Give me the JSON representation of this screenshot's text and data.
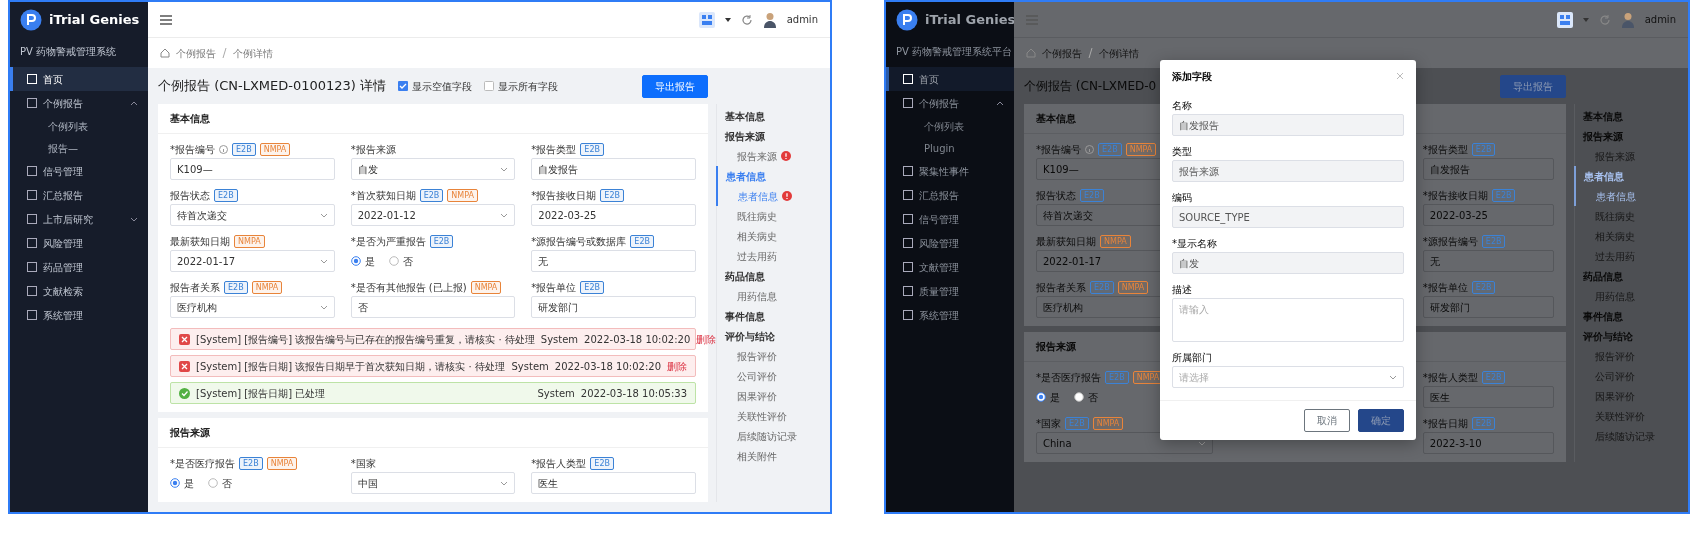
{
  "screens": [
    {
      "brand": "iTrial Genies",
      "subtitle": "PV 药物警戒管理系统",
      "menu": [
        {
          "label": "首页",
          "selected": true
        },
        {
          "label": "个例报告",
          "selected": false,
          "expanded": true,
          "children": [
            {
              "label": "个例列表"
            },
            {
              "label": "报告—"
            }
          ]
        },
        {
          "label": "信号管理",
          "selected": false
        },
        {
          "label": "汇总报告",
          "selected": false
        },
        {
          "label": "上市后研究",
          "selected": false,
          "expanded": false
        },
        {
          "label": "风险管理",
          "selected": false
        },
        {
          "label": "药品管理",
          "selected": false
        },
        {
          "label": "文献检索",
          "selected": false
        },
        {
          "label": "系统管理",
          "selected": false
        }
      ],
      "user": "admin",
      "breadcrumb": [
        "个例报告",
        "个例详情"
      ],
      "title": "个例报告 (CN-LXMED-0100123) 详情",
      "toggles": [
        {
          "label": "显示空值字段",
          "checked": true
        },
        {
          "label": "显示所有字段",
          "checked": false
        }
      ],
      "action": "导出报告",
      "sections": [
        {
          "title": "基本信息",
          "rows": [
            [
              {
                "label": "*报告编号",
                "info": true,
                "tags": [
                  {
                    "text": "E2B",
                    "color": "#3b82d6"
                  },
                  {
                    "text": "NMPA",
                    "color": "#e8843a"
                  }
                ],
                "kind": "input",
                "value": "K109—"
              },
              {
                "label": "*报告来源",
                "kind": "select",
                "value": "自发"
              },
              {
                "label": "*报告类型",
                "tags": [
                  {
                    "text": "E2B",
                    "color": "#3b82d6"
                  }
                ],
                "kind": "input",
                "value": "自发报告"
              }
            ],
            [
              {
                "label": "报告状态",
                "tags": [
                  {
                    "text": "E2B",
                    "color": "#3b82d6"
                  }
                ],
                "kind": "select",
                "value": "待首次递交"
              },
              {
                "label": "*首次获知日期",
                "tags": [
                  {
                    "text": "E2B",
                    "color": "#3b82d6"
                  },
                  {
                    "text": "NMPA",
                    "color": "#e8843a"
                  }
                ],
                "kind": "select",
                "value": "2022-01-12"
              },
              {
                "label": "*报告接收日期",
                "tags": [
                  {
                    "text": "E2B",
                    "color": "#3b82d6"
                  }
                ],
                "kind": "input",
                "value": "2022-03-25"
              }
            ],
            [
              {
                "label": "最新获知日期",
                "tags": [
                  {
                    "text": "NMPA",
                    "color": "#e8843a"
                  }
                ],
                "kind": "select",
                "value": "2022-01-17"
              },
              {
                "label": "*是否为严重报告",
                "tags": [
                  {
                    "text": "E2B",
                    "color": "#3b82d6"
                  }
                ],
                "kind": "radio",
                "options": [
                  {
                    "label": "是",
                    "selected": true
                  },
                  {
                    "label": "否",
                    "selected": false
                  }
                ]
              },
              {
                "label": "*源报告编号或数据库",
                "tags": [
                  {
                    "text": "E2B",
                    "color": "#3b82d6"
                  }
                ],
                "kind": "input",
                "value": "无"
              }
            ],
            [
              {
                "label": "报告者关系",
                "tags": [
                  {
                    "text": "E2B",
                    "color": "#3b82d6"
                  },
                  {
                    "text": "NMPA",
                    "color": "#e8843a"
                  }
                ],
                "kind": "select",
                "value": "医疗机构"
              },
              {
                "label": "*是否有其他报告 (已上报)",
                "tags": [
                  {
                    "text": "NMPA",
                    "color": "#e8843a"
                  }
                ],
                "kind": "input",
                "value": "否"
              },
              {
                "label": "*报告单位",
                "tags": [
                  {
                    "text": "E2B",
                    "color": "#3b82d6"
                  }
                ],
                "kind": "input",
                "value": "研发部门"
              }
            ]
          ],
          "alerts": [
            {
              "kind": "error",
              "text": "[System] [报告编号] 该报告编号与已存在的报告编号重复，请核实 · 待处理",
              "author": "System",
              "time": "2022-03-18 10:02:20",
              "action": "删除"
            },
            {
              "kind": "error",
              "text": "[System] [报告日期] 该报告日期早于首次获知日期，请核实 · 待处理",
              "author": "System",
              "time": "2022-03-18 10:02:20",
              "action": "删除"
            },
            {
              "kind": "success",
              "text": "[System] [报告日期] 已处理",
              "author": "System",
              "time": "2022-03-18 10:05:33"
            }
          ]
        },
        {
          "title": "报告来源",
          "rows": [
            [
              {
                "label": "*是否医疗报告",
                "tags": [
                  {
                    "text": "E2B",
                    "color": "#3b82d6"
                  },
                  {
                    "text": "NMPA",
                    "color": "#e8843a"
                  }
                ],
                "kind": "radio",
                "options": [
                  {
                    "label": "是",
                    "selected": true
                  },
                  {
                    "label": "否",
                    "selected": false
                  }
                ]
              },
              {
                "label": "*国家",
                "kind": "select",
                "value": "中国"
              },
              {
                "label": "*报告人类型",
                "tags": [
                  {
                    "text": "E2B",
                    "color": "#3b82d6"
                  }
                ],
                "kind": "input",
                "value": "医生"
              }
            ]
          ]
        }
      ],
      "anchors": [
        {
          "label": "基本信息",
          "selected": false
        },
        {
          "label": "报告来源",
          "selected": false,
          "children": [
            {
              "label": "报告来源",
              "selected": false,
              "flagged": true
            }
          ]
        },
        {
          "label": "患者信息",
          "selected": true,
          "children": [
            {
              "label": "患者信息",
              "selected": true,
              "flagged": true
            },
            {
              "label": "既往病史",
              "selected": false,
              "flagged": false
            },
            {
              "label": "相关病史",
              "selected": false,
              "flagged": false
            },
            {
              "label": "过去用药",
              "selected": false,
              "flagged": false
            }
          ]
        },
        {
          "label": "药品信息",
          "selected": false,
          "children": [
            {
              "label": "用药信息",
              "selected": false,
              "flagged": false
            }
          ]
        },
        {
          "label": "事件信息",
          "selected": false
        },
        {
          "label": "评价与结论",
          "selected": false,
          "children": [
            {
              "label": "报告评价",
              "selected": false,
              "flagged": false
            },
            {
              "label": "公司评价",
              "selected": false,
              "flagged": false
            },
            {
              "label": "因果评价",
              "selected": false,
              "flagged": false
            },
            {
              "label": "关联性评价",
              "selected": false,
              "flagged": false
            },
            {
              "label": "后续随访记录",
              "selected": false,
              "flagged": false
            },
            {
              "label": "相关附件",
              "selected": false,
              "flagged": false
            }
          ]
        }
      ]
    },
    {
      "brand": "iTrial Genies",
      "subtitle": "PV 药物警戒管理系统平台",
      "menu": [
        {
          "label": "首页",
          "selected": true
        },
        {
          "label": "个例报告",
          "selected": false,
          "expanded": true,
          "children": [
            {
              "label": "个例列表"
            },
            {
              "label": "Plugin"
            }
          ]
        },
        {
          "label": "聚集性事件",
          "selected": false
        },
        {
          "label": "汇总报告",
          "selected": false
        },
        {
          "label": "信号管理",
          "selected": false
        },
        {
          "label": "风险管理",
          "selected": false
        },
        {
          "label": "文献管理",
          "selected": false
        },
        {
          "label": "质量管理",
          "selected": false
        },
        {
          "label": "系统管理",
          "selected": false
        }
      ],
      "user": "admin",
      "breadcrumb": [
        "个例报告",
        "个例详情"
      ],
      "title": "个例报告 (CN-LXMED-0",
      "action": "导出报告",
      "sections": [
        {
          "title": "基本信息",
          "rows": [
            [
              {
                "label": "*报告编号",
                "info": true,
                "tags": [
                  {
                    "text": "E2B",
                    "color": "#3b82d6"
                  },
                  {
                    "text": "NMPA",
                    "color": "#e8843a"
                  }
                ],
                "kind": "input",
                "value": "K109—"
              },
              {
                "label": "*报告类型",
                "tags": [
                  {
                    "text": "E2B",
                    "color": "#3b82d6"
                  }
                ],
                "kind": "input",
                "value": "自发报告"
              }
            ],
            [
              {
                "label": "报告状态",
                "tags": [
                  {
                    "text": "E2B",
                    "color": "#3b82d6"
                  }
                ],
                "kind": "input",
                "value": "待首次递交"
              },
              {
                "label": "*报告接收日期",
                "tags": [
                  {
                    "text": "E2B",
                    "color": "#3b82d6"
                  }
                ],
                "kind": "input",
                "value": "2022-03-25"
              }
            ],
            [
              {
                "label": "最新获知日期",
                "tags": [
                  {
                    "text": "NMPA",
                    "color": "#e8843a"
                  }
                ],
                "kind": "input",
                "value": "2022-01-17"
              },
              {
                "label": "*源报告编号",
                "tags": [
                  {
                    "text": "E2B",
                    "color": "#3b82d6"
                  }
                ],
                "kind": "input",
                "value": "无"
              }
            ],
            [
              {
                "label": "报告者关系",
                "tags": [
                  {
                    "text": "E2B",
                    "color": "#3b82d6"
                  },
                  {
                    "text": "NMPA",
                    "color": "#e8843a"
                  }
                ],
                "kind": "input",
                "value": "医疗机构"
              },
              {
                "label": "*报告单位",
                "tags": [
                  {
                    "text": "E2B",
                    "color": "#3b82d6"
                  }
                ],
                "kind": "input",
                "value": "研发部门"
              }
            ]
          ]
        },
        {
          "title": "报告来源",
          "rows": [
            [
              {
                "label": "*是否医疗报告",
                "tags": [
                  {
                    "text": "E2B",
                    "color": "#3b82d6"
                  },
                  {
                    "text": "NMPA",
                    "color": "#e8843a"
                  }
                ],
                "kind": "radio",
                "options": [
                  {
                    "label": "是",
                    "selected": true
                  },
                  {
                    "label": "否",
                    "selected": false
                  }
                ]
              },
              {
                "label": "*报告人类型",
                "tags": [
                  {
                    "text": "E2B",
                    "color": "#3b82d6"
                  }
                ],
                "kind": "input",
                "value": "医生"
              }
            ],
            [
              {
                "label": "*国家",
                "tags": [
                  {
                    "text": "E2B",
                    "color": "#3b82d6"
                  },
                  {
                    "text": "NMPA",
                    "color": "#e8843a"
                  }
                ],
                "kind": "select",
                "value": "China"
              },
              {
                "label": "*报告日期",
                "tags": [
                  {
                    "text": "E2B",
                    "color": "#3b82d6"
                  }
                ],
                "kind": "input",
                "value": "2022-3-10"
              }
            ]
          ]
        }
      ],
      "anchors": [
        {
          "label": "基本信息",
          "selected": false
        },
        {
          "label": "报告来源",
          "selected": false,
          "children": [
            {
              "label": "报告来源",
              "selected": false
            }
          ]
        },
        {
          "label": "患者信息",
          "selected": true,
          "children": [
            {
              "label": "患者信息",
              "selected": true
            },
            {
              "label": "既往病史",
              "selected": false
            },
            {
              "label": "相关病史",
              "selected": false
            },
            {
              "label": "过去用药",
              "selected": false
            }
          ]
        },
        {
          "label": "药品信息",
          "selected": false,
          "children": [
            {
              "label": "用药信息",
              "selected": false
            }
          ]
        },
        {
          "label": "事件信息",
          "selected": false
        },
        {
          "label": "评价与结论",
          "selected": false,
          "children": [
            {
              "label": "报告评价",
              "selected": false
            },
            {
              "label": "公司评价",
              "selected": false
            },
            {
              "label": "因果评价",
              "selected": false
            },
            {
              "label": "关联性评价",
              "selected": false
            },
            {
              "label": "后续随访记录",
              "selected": false
            }
          ]
        }
      ],
      "modal": {
        "title": "添加字段",
        "fields": [
          {
            "label": "名称",
            "kind": "input",
            "value": "自发报告",
            "disabled": true
          },
          {
            "label": "类型",
            "kind": "input",
            "value": "报告来源",
            "disabled": true
          },
          {
            "label": "编码",
            "kind": "input",
            "value": "SOURCE_TYPE",
            "disabled": true
          },
          {
            "label": "*显示名称",
            "kind": "input",
            "value": "自发",
            "disabled": true
          },
          {
            "label": "描述",
            "kind": "textarea",
            "placeholder": "请输入",
            "disabled": false
          },
          {
            "label": "所属部门",
            "kind": "select",
            "placeholder": "请选择",
            "disabled": false
          }
        ],
        "buttons": [
          {
            "label": "取消",
            "kind": "secondary"
          },
          {
            "label": "确定",
            "kind": "primary"
          }
        ]
      }
    }
  ]
}
